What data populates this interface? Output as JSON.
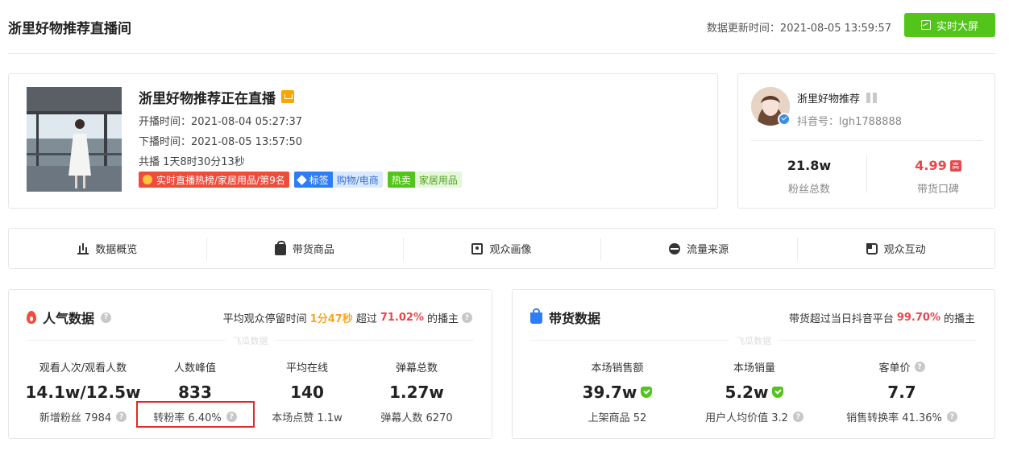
{
  "header": {
    "title": "浙里好物推荐直播间",
    "update_time": "数据更新时间：2021-08-05 13:59:57",
    "bigscreen_label": "实时大屏"
  },
  "live": {
    "title": "浙里好物推荐正在直播",
    "start": "开播时间：2021-08-04 05:27:37",
    "end": "下播时间：2021-08-05 13:57:50",
    "duration": "共播 1天8时30分13秒",
    "tags": {
      "rank": "实时直播热榜/家居用品/第9名",
      "label_key": "标签",
      "label_value": "购物/电商",
      "hot_key": "热卖",
      "hot_value": "家居用品"
    }
  },
  "anchor": {
    "name": "浙里好物推荐",
    "douyin_id": "抖音号：lgh1788888",
    "fans_value": "21.8w",
    "fans_label": "粉丝总数",
    "rating_value": "4.99",
    "rating_badge": "高",
    "rating_label": "带货口碑"
  },
  "tabs": [
    "数据概览",
    "带货商品",
    "观众画像",
    "流量来源",
    "观众互动"
  ],
  "popularity": {
    "title": "人气数据",
    "summary_prefix": "平均观众停留时间",
    "stay_time": "1分47秒",
    "summary_mid": "超过",
    "beat_pct": "71.02%",
    "summary_suffix": "的播主",
    "watermark": "飞瓜数据",
    "metrics": [
      {
        "label": "观看人次/观看人数",
        "value": "14.1w/12.5w",
        "sub": "新增粉丝 7984"
      },
      {
        "label": "人数峰值",
        "value": "833",
        "sub": "转粉率 6.40%"
      },
      {
        "label": "平均在线",
        "value": "140",
        "sub": "本场点赞 1.1w"
      },
      {
        "label": "弹幕总数",
        "value": "1.27w",
        "sub": "弹幕人数 6270"
      }
    ]
  },
  "sales": {
    "title": "带货数据",
    "summary_prefix": "带货超过当日抖音平台",
    "beat_pct": "99.70%",
    "summary_suffix": "的播主",
    "watermark": "飞瓜数据",
    "metrics": [
      {
        "label": "本场销售额",
        "value": "39.7w",
        "sub": "上架商品 52"
      },
      {
        "label": "本场销量",
        "value": "5.2w",
        "sub": "用户人均价值 3.2"
      },
      {
        "label": "客单价",
        "value": "7.7",
        "sub": "销售转换率 41.36%"
      }
    ]
  },
  "colors": {
    "accent_green": "#52c41a",
    "highlight_red": "#e8474b",
    "highlight_orange": "#f5a623",
    "tag_blue": "#2f7df6"
  }
}
